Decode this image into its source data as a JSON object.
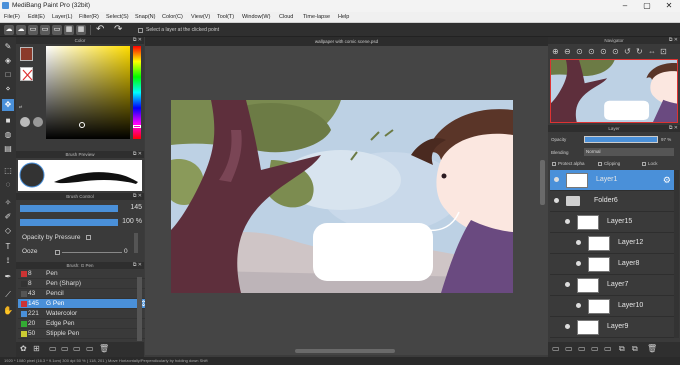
{
  "app": {
    "title": "MediBang Paint Pro (32bit)"
  },
  "menu": [
    "File(F)",
    "Edit(E)",
    "Layer(L)",
    "Filter(R)",
    "Select(S)",
    "Snap(N)",
    "Color(C)",
    "View(V)",
    "Tool(T)",
    "Window(W)",
    "Cloud",
    "Time-lapse",
    "Help"
  ],
  "commandbar": {
    "select_layer_label": "Select a layer at the clicked point"
  },
  "panels": {
    "color": "Color",
    "brush_preview": "Brush Preview",
    "brush_control": "Brush Control",
    "brush_list": "Brush: G Pen",
    "navigator": "Navigator",
    "layer": "Layer"
  },
  "document": {
    "tab": "wallpaper with comic scene.psd"
  },
  "brush_control": {
    "size_value": "145",
    "opacity_value": "100 %",
    "pressure_label": "Opacity by Pressure",
    "ooze_label": "Ooze",
    "ooze_value": "0"
  },
  "brushes": [
    {
      "size": "8",
      "name": "Pen",
      "color": "#cc3333"
    },
    {
      "size": "8",
      "name": "Pen (Sharp)",
      "color": "#333333"
    },
    {
      "size": "43",
      "name": "Pencil",
      "color": "#555555"
    },
    {
      "size": "145",
      "name": "G Pen",
      "color": "#cc3333",
      "selected": true
    },
    {
      "size": "221",
      "name": "Watercolor",
      "color": "#4a90d9"
    },
    {
      "size": "20",
      "name": "Edge Pen",
      "color": "#33aa33"
    },
    {
      "size": "50",
      "name": "Stipple Pen",
      "color": "#cccc33"
    }
  ],
  "layer_panel": {
    "opacity_label": "Opacity",
    "opacity_value": "97 %",
    "blending_label": "Blending",
    "blending_value": "Normal",
    "protect_alpha": "Protect alpha",
    "clipping": "Clipping",
    "lock": "Lock"
  },
  "layers": [
    {
      "name": "Layer1",
      "indent": 0,
      "selected": true,
      "type": "layer"
    },
    {
      "name": "Folder6",
      "indent": 0,
      "type": "folder"
    },
    {
      "name": "Layer15",
      "indent": 1,
      "type": "layer"
    },
    {
      "name": "Layer12",
      "indent": 2,
      "type": "layer"
    },
    {
      "name": "Layer8",
      "indent": 2,
      "type": "layer"
    },
    {
      "name": "Layer7",
      "indent": 1,
      "type": "layer"
    },
    {
      "name": "Layer10",
      "indent": 2,
      "type": "layer"
    },
    {
      "name": "Layer9",
      "indent": 1,
      "type": "layer"
    }
  ],
  "status": {
    "text": "1920 * 1080 pixel   (16.3 * 9.1cm)   300 dpi   50 %   ( 118, 201 )   Move Horizontally/Perpendicularly by holding down Shift"
  },
  "colors": {
    "accent": "#4a90d9",
    "fg_color": "#8b3a2a",
    "bg_color": "#ffffff"
  }
}
